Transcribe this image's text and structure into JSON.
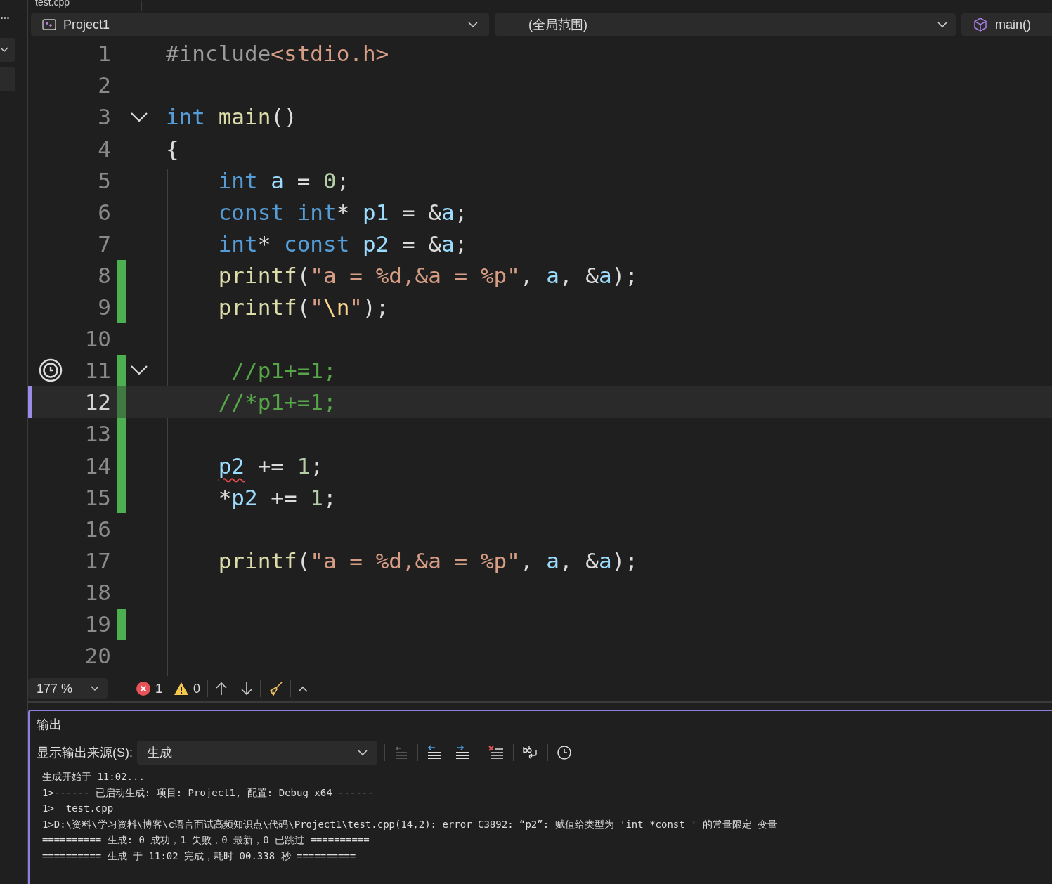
{
  "tab": {
    "label": "test.cpp"
  },
  "navigation_bar": {
    "project": "Project1",
    "scope": "(全局范围)",
    "member": "main()"
  },
  "editor": {
    "lines": [
      {
        "number": "1",
        "changed": false,
        "current": false,
        "foldable": false,
        "glyph": false,
        "tokens": [
          {
            "kind": "preprocessor",
            "text": "#include"
          },
          {
            "kind": "string",
            "text": "<stdio.h>"
          }
        ]
      },
      {
        "number": "2",
        "changed": false,
        "current": false,
        "foldable": false,
        "glyph": false
      },
      {
        "number": "3",
        "changed": false,
        "current": false,
        "foldable": true,
        "glyph": false,
        "tokens": [
          {
            "kind": "keyword",
            "text": "int"
          },
          {
            "kind": "function",
            "text": " main"
          },
          {
            "kind": "plain",
            "text": "()"
          }
        ]
      },
      {
        "number": "4",
        "changed": false,
        "current": false,
        "foldable": false,
        "glyph": false,
        "tokens": [
          {
            "kind": "plain",
            "text": "{"
          }
        ]
      },
      {
        "number": "5",
        "changed": false,
        "current": false,
        "foldable": false,
        "glyph": false,
        "tokens": [
          {
            "kind": "keyword",
            "text": "    int"
          },
          {
            "kind": "variable",
            "text": " a"
          },
          {
            "kind": "plain",
            "text": " = "
          },
          {
            "kind": "number",
            "text": "0"
          },
          {
            "kind": "plain",
            "text": ";"
          }
        ]
      },
      {
        "number": "6",
        "changed": false,
        "current": false,
        "foldable": false,
        "glyph": false,
        "tokens": [
          {
            "kind": "keyword",
            "text": "    const"
          },
          {
            "kind": "keyword",
            "text": " int"
          },
          {
            "kind": "plain",
            "text": "* "
          },
          {
            "kind": "variable",
            "text": "p1"
          },
          {
            "kind": "plain",
            "text": " = &"
          },
          {
            "kind": "variable",
            "text": "a"
          },
          {
            "kind": "plain",
            "text": ";"
          }
        ]
      },
      {
        "number": "7",
        "changed": false,
        "current": false,
        "foldable": false,
        "glyph": false,
        "tokens": [
          {
            "kind": "keyword",
            "text": "    int"
          },
          {
            "kind": "plain",
            "text": "* "
          },
          {
            "kind": "keyword",
            "text": "const"
          },
          {
            "kind": "variable",
            "text": " p2"
          },
          {
            "kind": "plain",
            "text": " = &"
          },
          {
            "kind": "variable",
            "text": "a"
          },
          {
            "kind": "plain",
            "text": ";"
          }
        ]
      },
      {
        "number": "8",
        "changed": true,
        "current": false,
        "foldable": false,
        "glyph": false,
        "tokens": [
          {
            "kind": "function",
            "text": "    printf"
          },
          {
            "kind": "plain",
            "text": "("
          },
          {
            "kind": "string",
            "text": "\"a = %d,&a = %p\""
          },
          {
            "kind": "plain",
            "text": ", "
          },
          {
            "kind": "variable",
            "text": "a"
          },
          {
            "kind": "plain",
            "text": ", &"
          },
          {
            "kind": "variable",
            "text": "a"
          },
          {
            "kind": "plain",
            "text": ");"
          }
        ]
      },
      {
        "number": "9",
        "changed": true,
        "current": false,
        "foldable": false,
        "glyph": false,
        "tokens": [
          {
            "kind": "function",
            "text": "    printf"
          },
          {
            "kind": "plain",
            "text": "("
          },
          {
            "kind": "string",
            "text": "\""
          },
          {
            "kind": "escape",
            "text": "\\n"
          },
          {
            "kind": "string",
            "text": "\""
          },
          {
            "kind": "plain",
            "text": ");"
          }
        ]
      },
      {
        "number": "10",
        "changed": false,
        "current": false,
        "foldable": false,
        "glyph": false
      },
      {
        "number": "11",
        "changed": true,
        "current": false,
        "foldable": true,
        "glyph": true,
        "tokens": [
          {
            "kind": "comment",
            "text": "     //p1+=1;"
          }
        ]
      },
      {
        "number": "12",
        "changed": true,
        "current": true,
        "foldable": false,
        "glyph": false,
        "tokens": [
          {
            "kind": "comment",
            "text": "    //*p1+=1;"
          }
        ]
      },
      {
        "number": "13",
        "changed": true,
        "current": false,
        "foldable": false,
        "glyph": false
      },
      {
        "number": "14",
        "changed": true,
        "current": false,
        "foldable": false,
        "glyph": false,
        "tokens": [
          {
            "kind": "variable",
            "text": "    p2",
            "error": true
          },
          {
            "kind": "plain",
            "text": " += "
          },
          {
            "kind": "number",
            "text": "1"
          },
          {
            "kind": "plain",
            "text": ";"
          }
        ]
      },
      {
        "number": "15",
        "changed": true,
        "current": false,
        "foldable": false,
        "glyph": false,
        "tokens": [
          {
            "kind": "plain",
            "text": "    *"
          },
          {
            "kind": "variable",
            "text": "p2"
          },
          {
            "kind": "plain",
            "text": " += "
          },
          {
            "kind": "number",
            "text": "1"
          },
          {
            "kind": "plain",
            "text": ";"
          }
        ]
      },
      {
        "number": "16",
        "changed": false,
        "current": false,
        "foldable": false,
        "glyph": false
      },
      {
        "number": "17",
        "changed": false,
        "current": false,
        "foldable": false,
        "glyph": false,
        "tokens": [
          {
            "kind": "function",
            "text": "    printf"
          },
          {
            "kind": "plain",
            "text": "("
          },
          {
            "kind": "string",
            "text": "\"a = %d,&a = %p\""
          },
          {
            "kind": "plain",
            "text": ", "
          },
          {
            "kind": "variable",
            "text": "a"
          },
          {
            "kind": "plain",
            "text": ", &"
          },
          {
            "kind": "variable",
            "text": "a"
          },
          {
            "kind": "plain",
            "text": ");"
          }
        ]
      },
      {
        "number": "18",
        "changed": false,
        "current": false,
        "foldable": false,
        "glyph": false
      },
      {
        "number": "19",
        "changed": true,
        "current": false,
        "foldable": false,
        "glyph": false
      },
      {
        "number": "20",
        "changed": false,
        "current": false,
        "foldable": false,
        "glyph": false
      }
    ]
  },
  "status_bar": {
    "zoom": "177 %",
    "errors": "1",
    "warnings": "0"
  },
  "output_panel": {
    "title": "输出",
    "source_label": "显示输出来源(S):",
    "source": "生成",
    "lines": [
      "生成开始于 11:02...",
      "1>------ 已启动生成: 项目: Project1, 配置: Debug x64 ------",
      "1>  test.cpp",
      "1>D:\\资料\\学习资料\\博客\\c语言面试高频知识点\\代码\\Project1\\test.cpp(14,2): error C3892: “p2”: 赋值给类型为 'int *const ' 的常量限定 变量",
      "========== 生成: 0 成功，1 失败，0 最新，0 已跳过 ==========",
      "========== 生成 于 11:02 完成，耗时 00.338 秒 =========="
    ]
  }
}
